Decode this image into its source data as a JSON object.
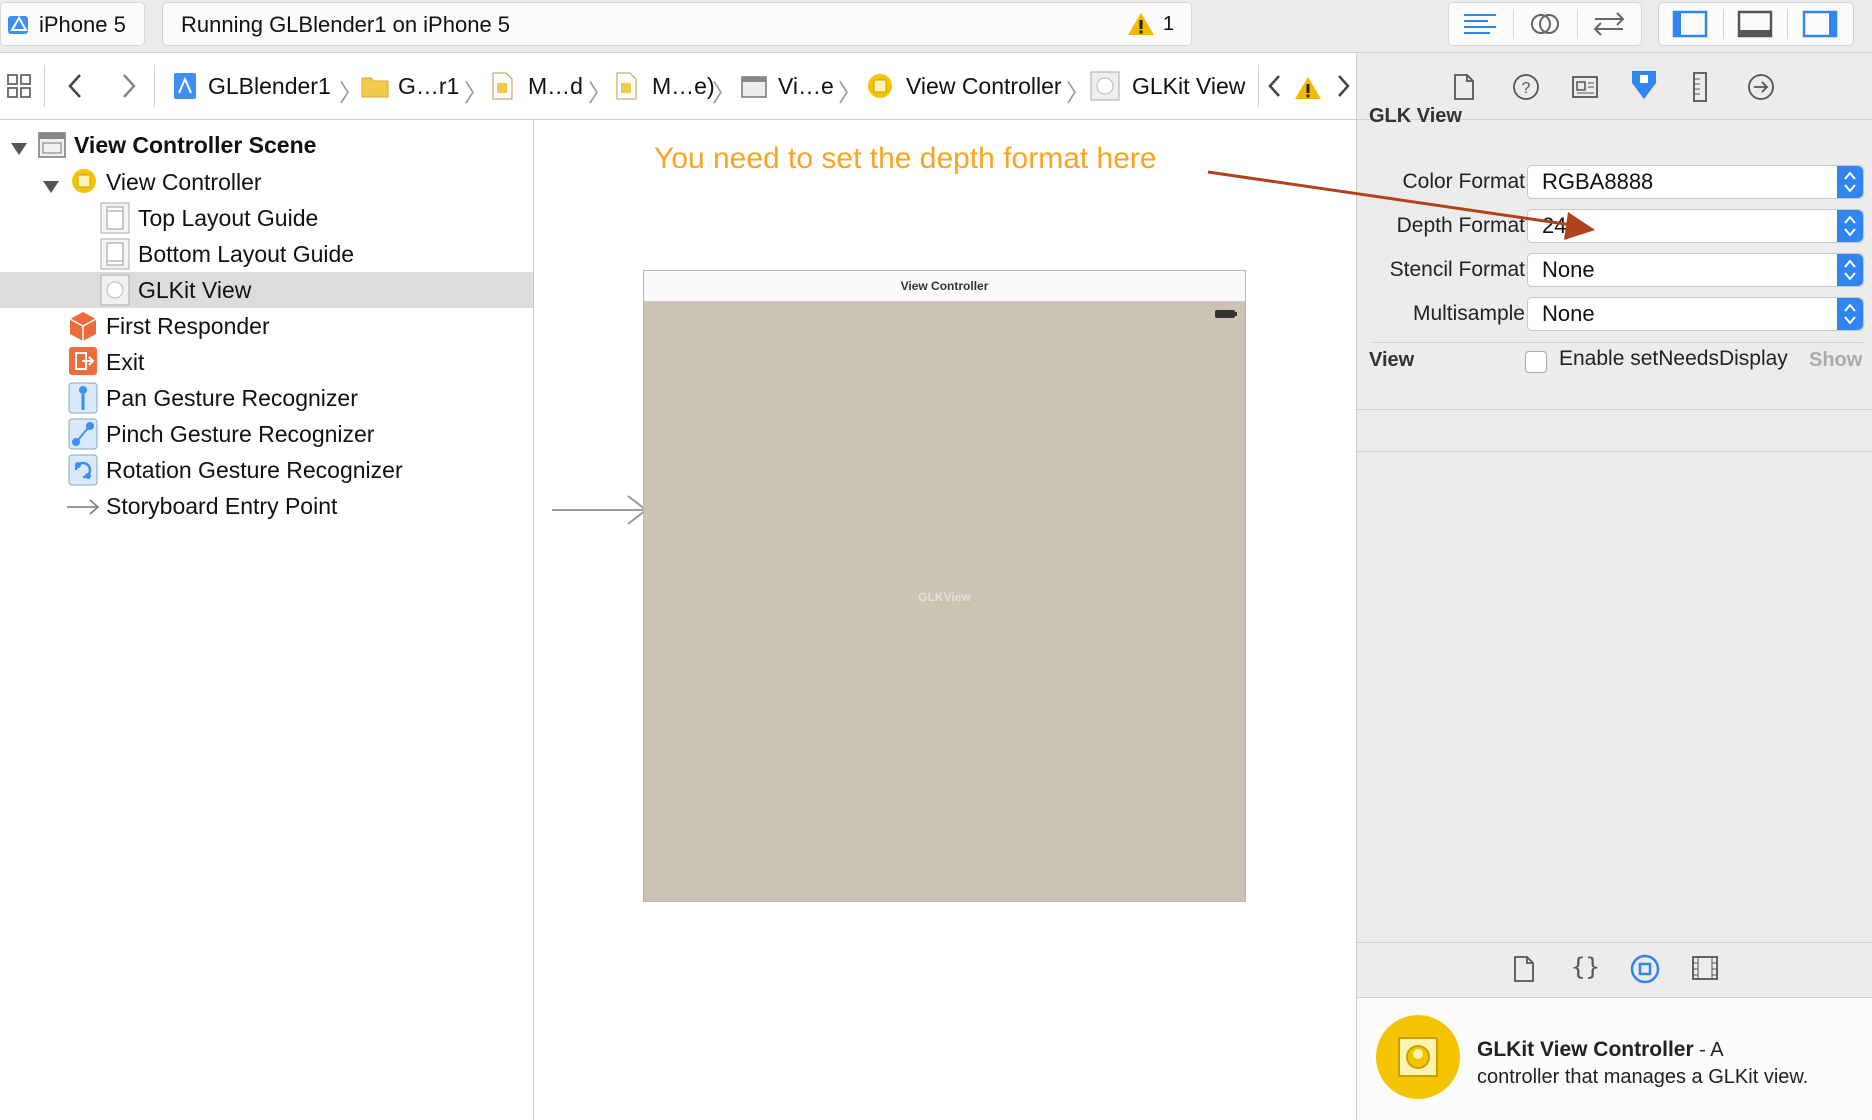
{
  "toolbar": {
    "scheme": "iPhone 5",
    "status": "Running GLBlender1 on iPhone 5",
    "warning_count": "1"
  },
  "jumpbar": {
    "crumbs": [
      "GLBlender1",
      "G…r1",
      "M…d",
      "M…e)",
      "Vi…e",
      "View Controller",
      "GLKit View"
    ]
  },
  "outline": {
    "scene": "View Controller Scene",
    "items": [
      "View Controller",
      "Top Layout Guide",
      "Bottom Layout Guide",
      "GLKit View",
      "First Responder",
      "Exit",
      "Pan Gesture Recognizer",
      "Pinch Gesture Recognizer",
      "Rotation Gesture Recognizer",
      "Storyboard Entry Point"
    ]
  },
  "canvas": {
    "annotation": "You need to set the depth format here",
    "vc_title": "View Controller",
    "glkview_label": "GLKView"
  },
  "inspector": {
    "section_glk": "GLK View",
    "color_format_label": "Color Format",
    "color_format_value": "RGBA8888",
    "depth_format_label": "Depth Format",
    "depth_format_value": "24",
    "stencil_format_label": "Stencil Format",
    "stencil_format_value": "None",
    "multisample_label": "Multisample",
    "multisample_value": "None",
    "enable_label": "Enable setNeedsDisplay",
    "section_view": "View",
    "show_label": "Show"
  },
  "library": {
    "title": "GLKit View Controller",
    "dash": " - A",
    "description": "controller that manages a GLKit view."
  },
  "colors": {
    "accent": "#2f86f0",
    "annotation": "#f5a623",
    "arrow": "#b0421c",
    "canvas_view": "#cbc3b3"
  }
}
